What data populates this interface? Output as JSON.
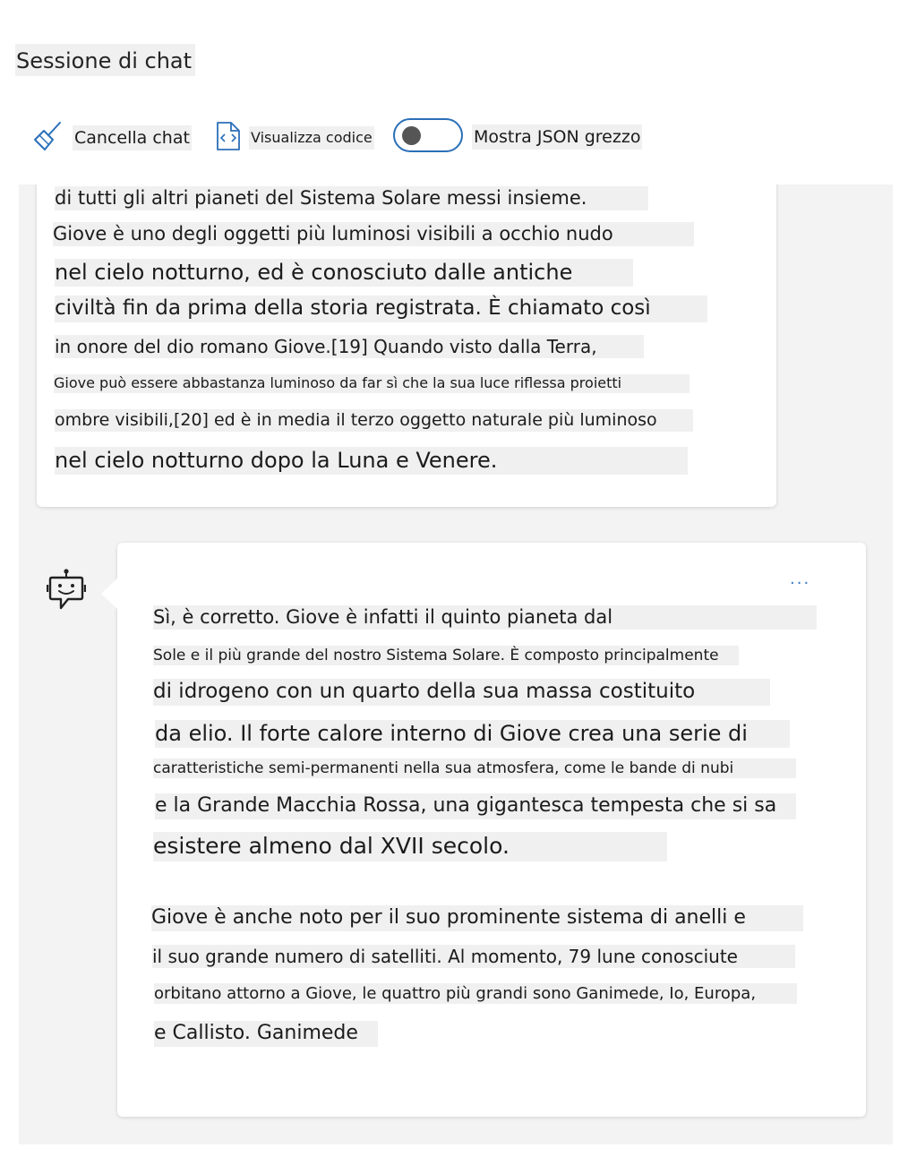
{
  "header": {
    "title": "Sessione di chat"
  },
  "toolbar": {
    "clear_label": "Cancella chat",
    "code_label": "Visualizza codice",
    "toggle_label": "Mostra JSON grezzo",
    "toggle_state": "off"
  },
  "user_message": {
    "lines": [
      "di tutti gli altri pianeti del Sistema Solare messi insieme.",
      "Giove è uno degli oggetti più luminosi visibili a occhio nudo",
      "nel cielo notturno, ed è conosciuto dalle antiche",
      "civiltà fin da prima della storia registrata. È chiamato così",
      "in onore del dio romano Giove.[19] Quando visto dalla Terra,",
      "Giove può essere abbastanza luminoso da far sì che la sua luce riflessa proietti",
      "ombre visibili,[20] ed è in media il terzo oggetto naturale più luminoso",
      "nel cielo notturno dopo la Luna e Venere."
    ]
  },
  "bot_message": {
    "more_label": "...",
    "lines": [
      "Sì, è corretto. Giove è infatti il quinto pianeta dal",
      "Sole e il più grande del nostro Sistema Solare. È composto principalmente",
      "di idrogeno con un quarto della sua massa costituito",
      "da elio. Il forte calore interno di Giove crea una serie di",
      "caratteristiche semi-permanenti nella sua atmosfera, come le bande di nubi",
      "e la Grande Macchia Rossa, una gigantesca tempesta che si sa",
      "esistere almeno dal XVII secolo.",
      "Giove è anche noto per il suo prominente sistema di anelli e",
      "il suo grande numero di satelliti. Al momento, 79 lune conosciute",
      "orbitano attorno a Giove, le quattro più grandi sono Ganimede, Io, Europa,",
      "e Callisto. Ganimede"
    ]
  },
  "icons": {
    "clear": "broom-icon",
    "code": "code-file-icon",
    "bot": "bot-icon",
    "more": "more-icon"
  },
  "colors": {
    "accent": "#2b6fb8",
    "highlight": "#f0f0f0",
    "chat_bg": "#f3f3f3"
  }
}
